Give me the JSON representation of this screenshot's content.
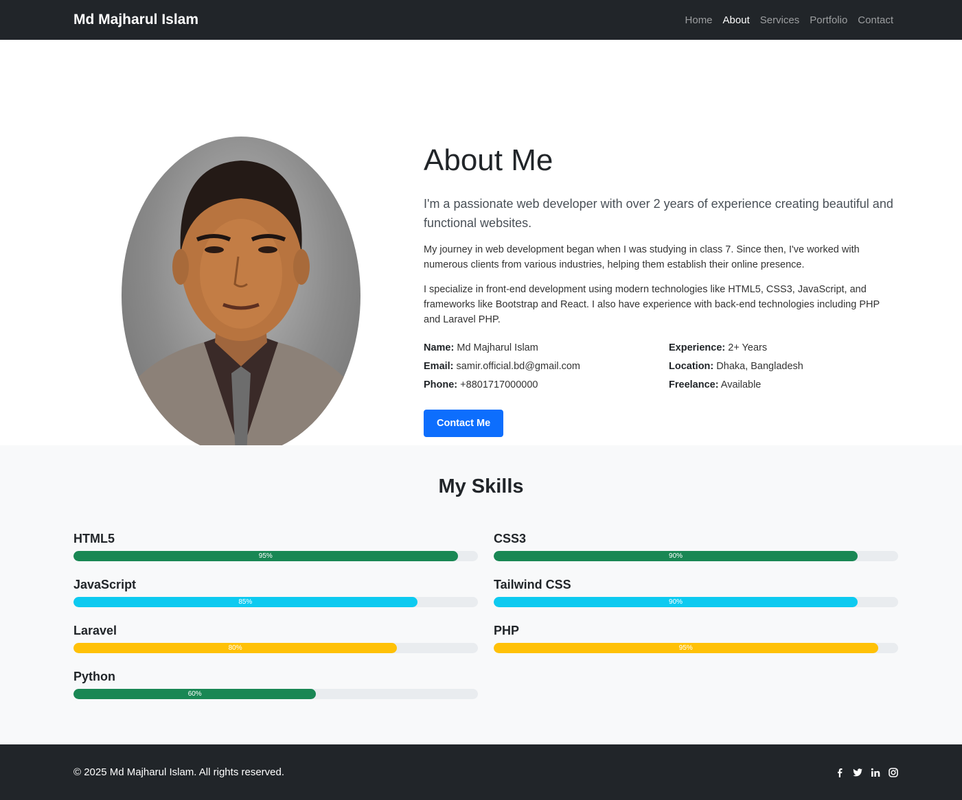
{
  "navbar": {
    "brand": "Md Majharul Islam",
    "links": [
      "Home",
      "About",
      "Services",
      "Portfolio",
      "Contact"
    ],
    "active": "About"
  },
  "about": {
    "title": "About Me",
    "lead": "I'm a passionate web developer with over 2 years of experience creating beautiful and functional websites.",
    "paragraphs": [
      "My journey in web development began when I was studying in class 7. Since then, I've worked with numerous clients from various industries, helping them establish their online presence.",
      "I specialize in front-end development using modern technologies like HTML5, CSS3, JavaScript, and frameworks like Bootstrap and React. I also have experience with back-end technologies including PHP and Laravel PHP."
    ],
    "info": [
      {
        "label": "Name:",
        "value": "Md Majharul Islam"
      },
      {
        "label": "Experience:",
        "value": "2+ Years"
      },
      {
        "label": "Email:",
        "value": "samir.official.bd@gmail.com"
      },
      {
        "label": "Location:",
        "value": "Dhaka, Bangladesh"
      },
      {
        "label": "Phone:",
        "value": "+8801717000000"
      },
      {
        "label": "Freelance:",
        "value": "Available"
      }
    ],
    "button": "Contact Me"
  },
  "skills": {
    "title": "My Skills",
    "items": [
      {
        "name": "HTML5",
        "percent": 95,
        "label": "95%",
        "color": "#198754"
      },
      {
        "name": "CSS3",
        "percent": 90,
        "label": "90%",
        "color": "#198754"
      },
      {
        "name": "JavaScript",
        "percent": 85,
        "label": "85%",
        "color": "#0dcaf0"
      },
      {
        "name": "Tailwind CSS",
        "percent": 90,
        "label": "90%",
        "color": "#0dcaf0"
      },
      {
        "name": "Laravel",
        "percent": 80,
        "label": "80%",
        "color": "#ffc107"
      },
      {
        "name": "PHP",
        "percent": 95,
        "label": "95%",
        "color": "#ffc107"
      },
      {
        "name": "Python",
        "percent": 60,
        "label": "60%",
        "color": "#198754"
      }
    ]
  },
  "footer": {
    "copyright": "© 2025 Md Majharul Islam. All rights reserved.",
    "social": [
      "facebook-icon",
      "twitter-icon",
      "linkedin-icon",
      "instagram-icon"
    ]
  }
}
